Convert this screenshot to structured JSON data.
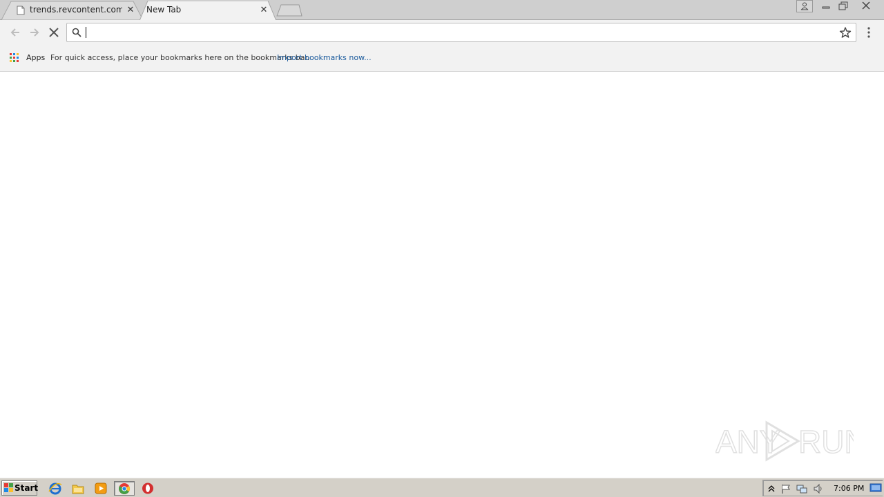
{
  "browser": {
    "tabs": [
      {
        "title": "trends.revcontent.com/serv",
        "active": false
      },
      {
        "title": "New Tab",
        "active": true
      }
    ],
    "omnibox": {
      "value": "",
      "placeholder": ""
    },
    "bookmarks_bar": {
      "apps_label": "Apps",
      "message": "For quick access, place your bookmarks here on the bookmarks bar.",
      "import_link": "Import bookmarks now..."
    }
  },
  "watermark": {
    "text_left": "ANY",
    "text_right": "RUN"
  },
  "taskbar": {
    "start_label": "Start",
    "clock": "7:06 PM"
  },
  "colors": {
    "tabstrip": "#cfcfcf",
    "toolbar": "#f2f2f2",
    "link": "#1a5a9c",
    "taskbar": "#d4d0c8"
  }
}
